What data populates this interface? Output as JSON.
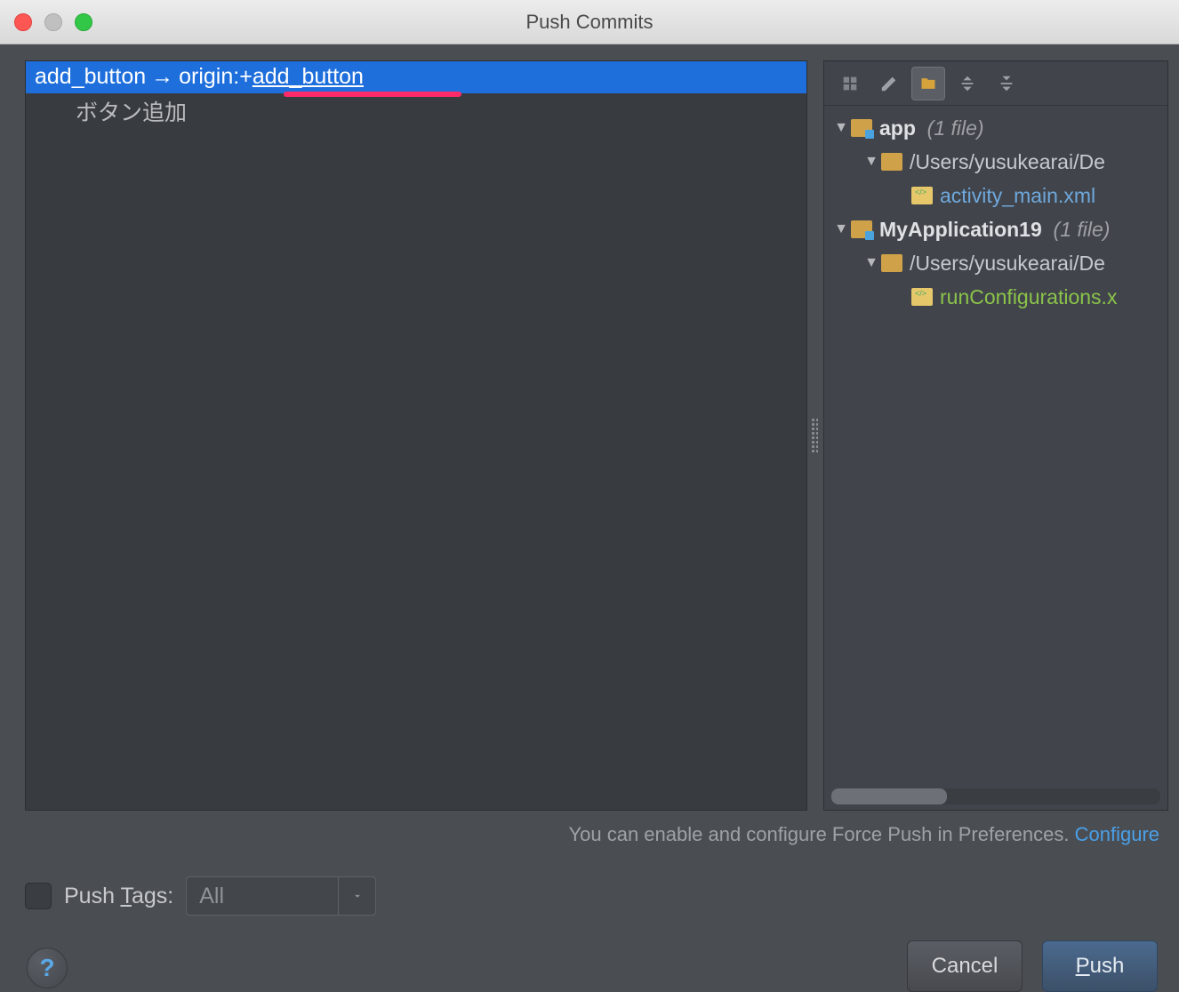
{
  "window": {
    "title": "Push Commits"
  },
  "branch": {
    "local": "add_button",
    "arrow": "→",
    "remote_name": "origin",
    "colon": " : ",
    "plus": "+",
    "remote_branch": "add_button"
  },
  "commits": {
    "first_message": "ボタン追加"
  },
  "hint": {
    "text": "You can enable and configure Force Push in Preferences. ",
    "link": "Configure"
  },
  "push_tags": {
    "label_before": "Push ",
    "label_underline": "T",
    "label_after": "ags:",
    "combo_value": "All"
  },
  "tree": {
    "node1": {
      "name": "app",
      "count_label": "(1 file)"
    },
    "node1_path": "/Users/yusukearai/De",
    "node1_file": "activity_main.xml",
    "node2": {
      "name": "MyApplication19",
      "count_label": "(1 file)"
    },
    "node2_path": "/Users/yusukearai/De",
    "node2_file": "runConfigurations.x"
  },
  "buttons": {
    "cancel": "Cancel",
    "push_underline": "P",
    "push_rest": "ush"
  },
  "help": "?"
}
